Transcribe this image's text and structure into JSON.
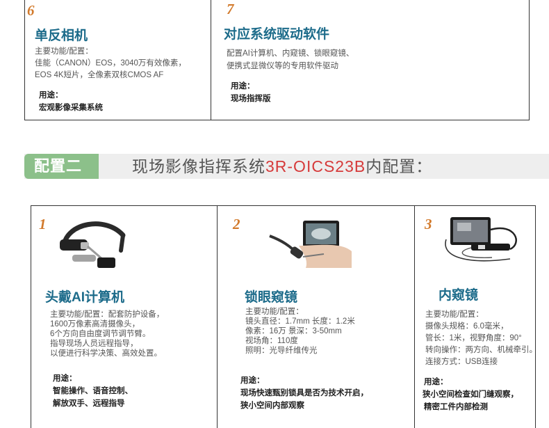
{
  "top_cards": [
    {
      "number": "6",
      "title": "单反相机",
      "desc": [
        "主要功能/配置：",
        "佳能（CANON）EOS，3040万有效像素，",
        "EOS 4K短片，全像素双核CMOS AF"
      ],
      "use_label": "用途：",
      "use": [
        "宏观影像采集系统"
      ]
    },
    {
      "number": "7",
      "title": "对应系统驱动软件",
      "desc": [
        "配置AI计算机、内窥镜、锁眼窥镜、",
        "便携式显微仪等的专用软件驱动"
      ],
      "use_label": "用途：",
      "use": [
        "现场指挥版"
      ]
    }
  ],
  "banner": {
    "badge": "配置二",
    "prefix": "现场影像指挥系统",
    "model": "3R-OICS23B",
    "suffix": "内配置："
  },
  "bottom_cards": [
    {
      "number": "1",
      "title": "头戴AI计算机",
      "image_icon": "headset-icon",
      "desc": [
        "主要功能/配置：配套防护设备，",
        "1600万像素高清摄像头，",
        "6个方向自由度调节调节臂。",
        "指导现场人员远程指导，",
        "以便进行科学决策、高效处置。"
      ],
      "use_label": "用途：",
      "use": [
        "智能操作、语音控制、",
        "解放双手、远程指导"
      ]
    },
    {
      "number": "2",
      "title": "锁眼窥镜",
      "image_icon": "keyhole-scope-icon",
      "desc": [
        "主要功能/配置：",
        "镜头直径：1.7mm 长度：1.2米",
        "像素：16万   景深：3-50mm",
        "视场角：110度",
        "照明：光导纤维传光"
      ],
      "use_label": "用途：",
      "use": [
        "现场快速甄别锁具是否为技术开启，",
        "狭小空间内部观察"
      ]
    },
    {
      "number": "3",
      "title": "内窥镜",
      "image_icon": "endoscope-icon",
      "desc": [
        "主要功能/配置：",
        "摄像头规格：6.0毫米，",
        "管长：1米，视野角度：90°",
        "转向操作：两方向、机械牵引。",
        "连接方式：USB连接"
      ],
      "use_label": "用途：",
      "use": [
        "狭小空间检查如门缝观察，",
        "精密工件内部检测"
      ]
    }
  ],
  "colors": {
    "number": "#d27a2c",
    "title": "#1c6b8a",
    "badge": "#8cc08a",
    "model": "#d63a3a"
  }
}
